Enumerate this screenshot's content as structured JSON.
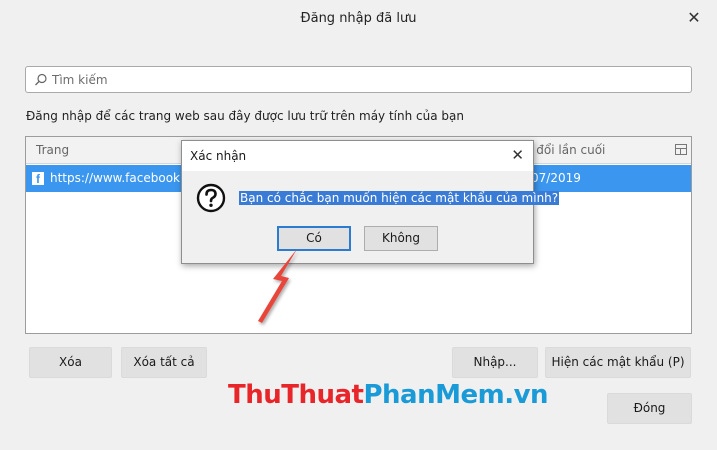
{
  "window": {
    "title": "Đăng nhập đã lưu",
    "close_symbol": "✕"
  },
  "search": {
    "placeholder": "Tìm kiếm",
    "icon": "search-icon"
  },
  "description": "Đăng nhập để các trang web sau đây được lưu trữ trên máy tính của bạn",
  "table": {
    "columns": [
      "Trang",
      "ay đổi lần cuối"
    ],
    "column_picker_icon": "column-picker-icon",
    "rows": [
      {
        "icon": "facebook-icon",
        "icon_glyph": "f",
        "site": "https://www.facebook.c",
        "changed": "07/2019"
      }
    ]
  },
  "buttons": {
    "delete": "Xóa",
    "delete_all": "Xóa tất cả",
    "import": "Nhập...",
    "show_passwords": "Hiện các mật khẩu (P)",
    "close": "Đóng"
  },
  "dialog": {
    "title": "Xác nhận",
    "close_symbol": "✕",
    "icon": "question-icon",
    "message": "Bạn có chắc bạn muốn hiện các mật khẩu của mình?",
    "yes": "Có",
    "no": "Không"
  },
  "watermark": {
    "part1": "ThuThuat",
    "part2": "PhanMem.vn"
  },
  "colors": {
    "selection": "#3a96ee",
    "arrow": "#e8453a",
    "watermark_red": "#e8262a",
    "watermark_blue": "#1a9ad6"
  }
}
